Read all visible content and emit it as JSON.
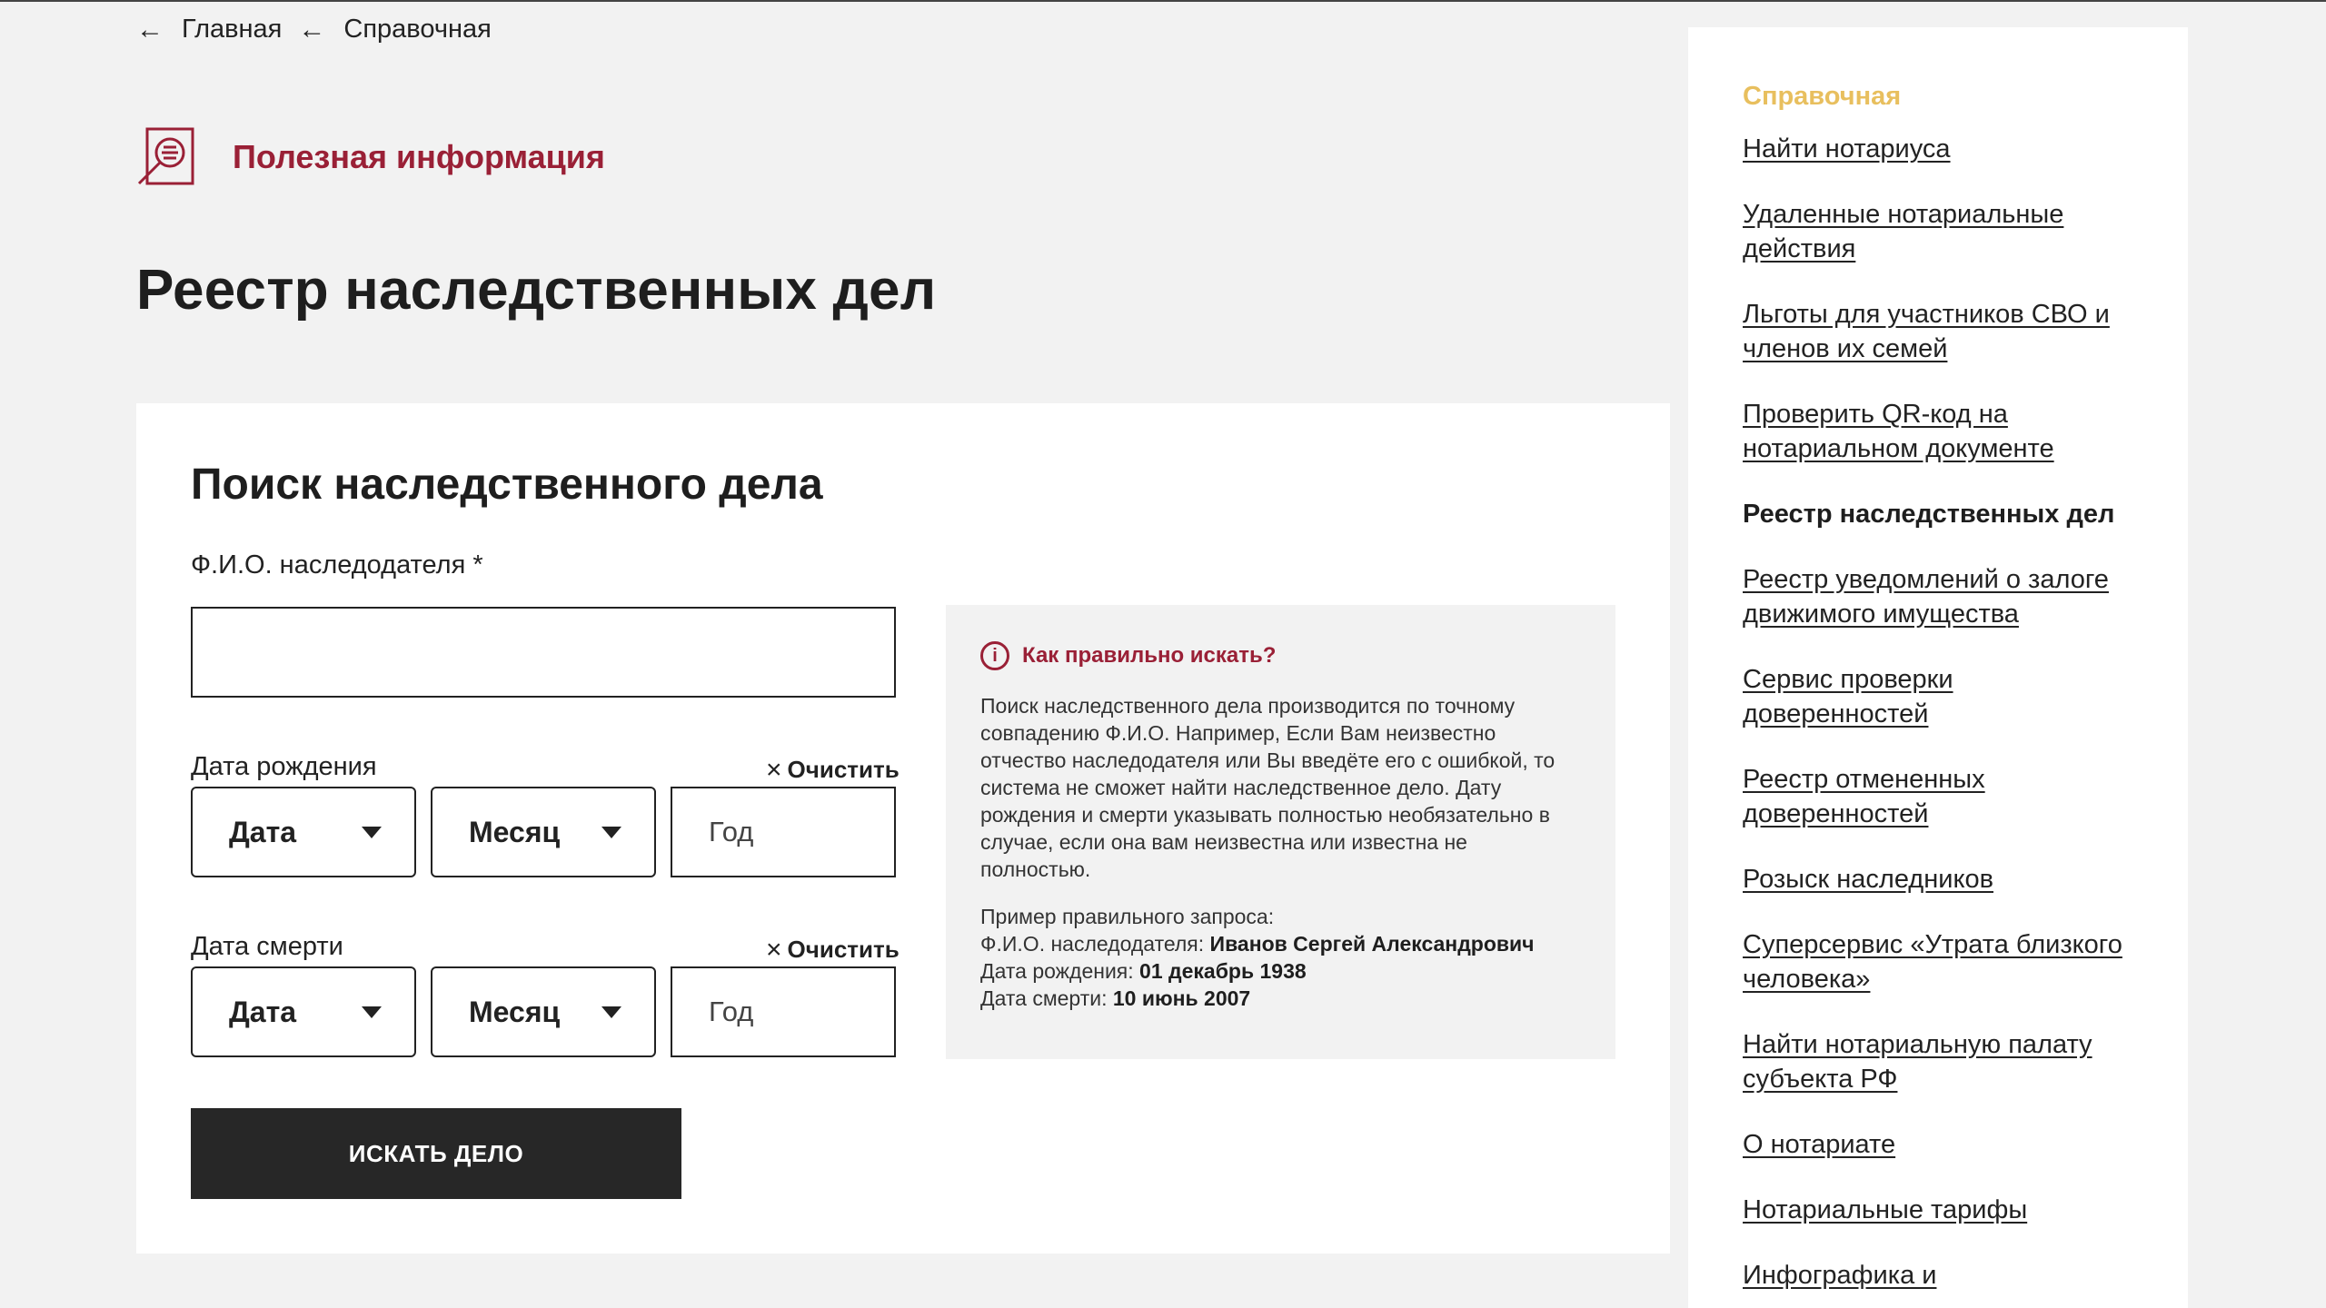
{
  "breadcrumb": [
    {
      "label": "Главная"
    },
    {
      "label": "Справочная"
    }
  ],
  "section": {
    "title": "Полезная информация",
    "icon": "document-search-icon"
  },
  "page": {
    "title": "Реестр наследственных дел"
  },
  "search_form": {
    "title": "Поиск наследственного дела",
    "name_label": "Ф.И.О. наследодателя *",
    "name_value": "",
    "birth": {
      "label": "Дата рождения",
      "clear_label": "Очистить",
      "day": "Дата",
      "month": "Месяц",
      "year_placeholder": "Год"
    },
    "death": {
      "label": "Дата смерти",
      "clear_label": "Очистить",
      "day": "Дата",
      "month": "Месяц",
      "year_placeholder": "Год"
    },
    "submit_label": "ИСКАТЬ ДЕЛО"
  },
  "help": {
    "title": "Как правильно искать?",
    "text": "Поиск наследственного дела производится по точному совпадению Ф.И.О. Например, Если Вам неизвестно отчество наследодателя или Вы введёте его с ошибкой, то система не сможет найти наследственное дело. Дату рождения и смерти указывать полностью необязательно в случае, если она вам неизвестна или известна не полностью.",
    "example_title": "Пример правильного запроса:",
    "example_name_label": "Ф.И.О. наследодателя:",
    "example_name_value": "Иванов Сергей Александрович",
    "example_birth_label": "Дата рождения:",
    "example_birth_value": "01 декабрь 1938",
    "example_death_label": "Дата смерти:",
    "example_death_value": "10 июнь 2007"
  },
  "sidebar": {
    "heading": "Справочная",
    "items": [
      {
        "label": "Найти нотариуса"
      },
      {
        "label": "Удаленные нотариальные действия"
      },
      {
        "label": "Льготы для участников СВО и членов их семей"
      },
      {
        "label": "Проверить QR-код на нотариальном документе"
      },
      {
        "label": "Реестр наследственных дел"
      },
      {
        "label": "Реестр уведомлений о залоге движимого имущества"
      },
      {
        "label": "Сервис проверки доверенностей"
      },
      {
        "label": "Реестр отмененных доверенностей"
      },
      {
        "label": "Розыск наследников"
      },
      {
        "label": "Суперсервис «Утрата близкого человека»"
      },
      {
        "label": "Найти нотариальную палату субъекта РФ"
      },
      {
        "label": "О нотариате"
      },
      {
        "label": "Нотариальные тарифы"
      },
      {
        "label": "Инфографика и"
      }
    ]
  },
  "colors": {
    "accent": "#9a2036",
    "sidebar_heading": "#e8bf5e",
    "button_bg": "#272727"
  }
}
